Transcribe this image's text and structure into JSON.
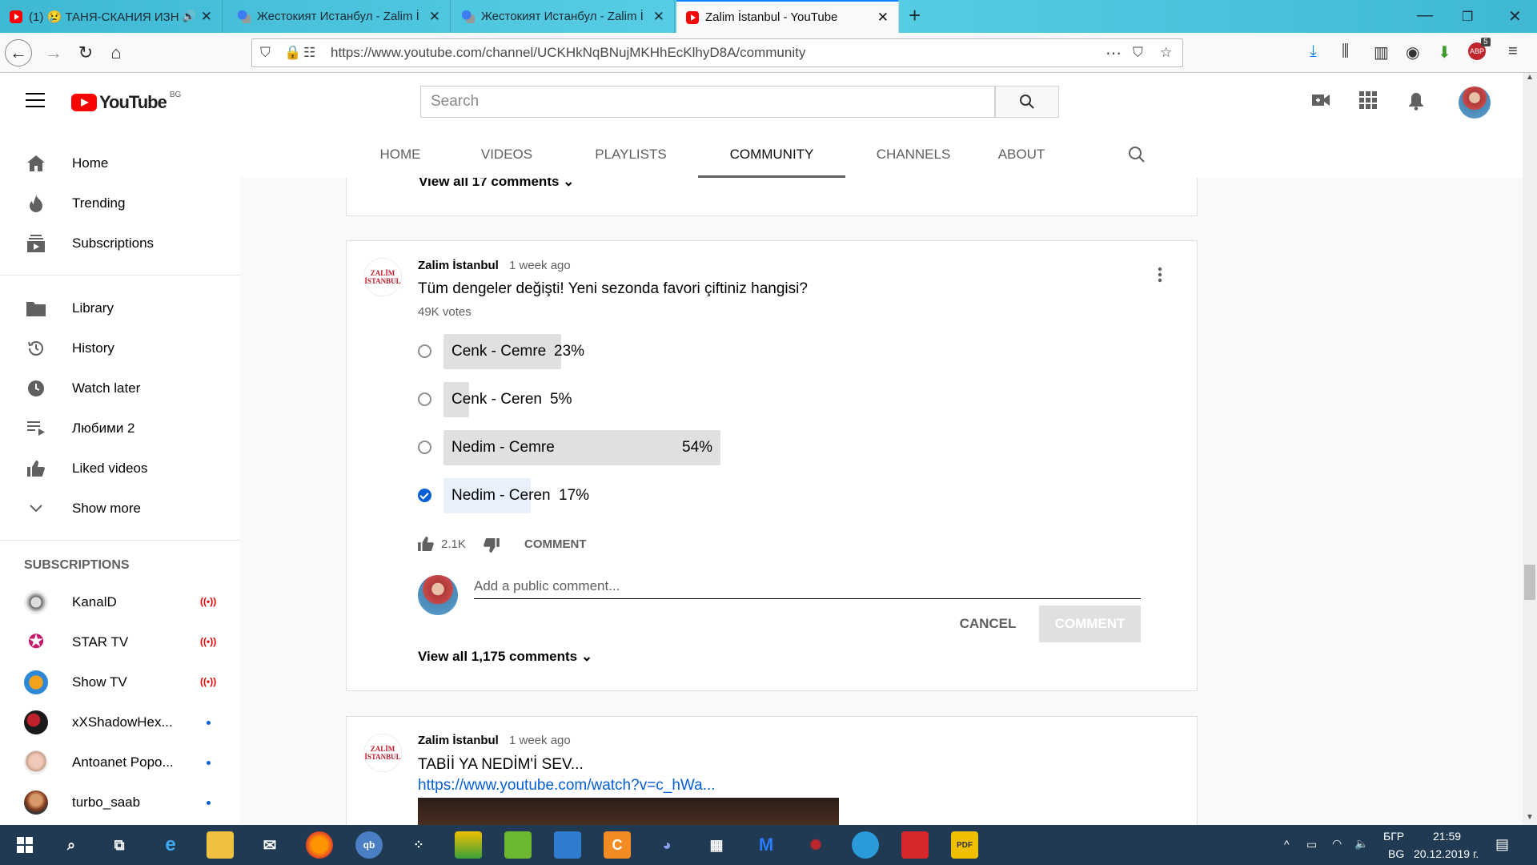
{
  "browser": {
    "tabs": [
      {
        "title": "(1) 😢 ТАНЯ-СКАНИЯ ИЗН",
        "icon": "youtube-icon"
      },
      {
        "title": "Жестокият Истанбул - Zalim İ",
        "icon": "translate-icon"
      },
      {
        "title": "Жестокият Истанбул - Zalim İ",
        "icon": "translate-icon"
      },
      {
        "title": "Zalim İstanbul - YouTube",
        "icon": "youtube-icon"
      }
    ],
    "url": "https://www.youtube.com/channel/UCKHkNqBNujMKHhEcKlhyD8A/community",
    "url_host": "www.youtube.com",
    "addon_badge": "5"
  },
  "youtube": {
    "logo_text": "YouTube",
    "country_code": "BG",
    "search_placeholder": "Search"
  },
  "sidebar": {
    "main": [
      {
        "label": "Home",
        "icon": "home-icon"
      },
      {
        "label": "Trending",
        "icon": "fire-icon"
      },
      {
        "label": "Subscriptions",
        "icon": "subscriptions-icon"
      }
    ],
    "library": [
      {
        "label": "Library",
        "icon": "folder-icon"
      },
      {
        "label": "History",
        "icon": "history-icon"
      },
      {
        "label": "Watch later",
        "icon": "clock-icon"
      },
      {
        "label": "Любими 2",
        "icon": "playlist-icon"
      },
      {
        "label": "Liked videos",
        "icon": "thumbs-up-icon"
      },
      {
        "label": "Show more",
        "icon": "chevron-down-icon"
      }
    ],
    "subscriptions_heading": "SUBSCRIPTIONS",
    "subscriptions": [
      {
        "name": "KanalD",
        "status": "live"
      },
      {
        "name": "STAR TV",
        "status": "live"
      },
      {
        "name": "Show TV",
        "status": "live"
      },
      {
        "name": "xXShadowHex...",
        "status": "new"
      },
      {
        "name": "Antoanet Popo...",
        "status": "new"
      },
      {
        "name": "turbo_saab",
        "status": "new"
      }
    ]
  },
  "channel_tabs": [
    "HOME",
    "VIDEOS",
    "PLAYLISTS",
    "COMMUNITY",
    "CHANNELS",
    "ABOUT"
  ],
  "selected_tab": "COMMUNITY",
  "prev_post": {
    "view_all": "View all 17 comments"
  },
  "poll_post": {
    "author": "Zalim İstanbul",
    "avatar_text": [
      "ZALİM",
      "İSTANBUL"
    ],
    "time": "1 week ago",
    "text": "Tüm dengeler değişti! Yeni sezonda favori çiftiniz hangisi?",
    "votes": "49K votes",
    "options": [
      {
        "label": "Cenk - Cemre",
        "percent": "23%",
        "fraction": 0.23,
        "selected": false
      },
      {
        "label": "Cenk - Ceren",
        "percent": "5%",
        "fraction": 0.05,
        "selected": false
      },
      {
        "label": "Nedim - Cemre",
        "percent": "54%",
        "fraction": 0.54,
        "selected": false
      },
      {
        "label": "Nedim - Ceren",
        "percent": "17%",
        "fraction": 0.17,
        "selected": true
      }
    ],
    "likes": "2.1K",
    "comment_label": "COMMENT",
    "comment_placeholder": "Add a public comment...",
    "cancel_label": "CANCEL",
    "submit_label": "COMMENT",
    "view_all": "View all 1,175 comments"
  },
  "next_post": {
    "author": "Zalim İstanbul",
    "time": "1 week ago",
    "text": "TABİİ YA NEDİM'İ SEV...",
    "link": "https://www.youtube.com/watch?v=c_hWa..."
  },
  "taskbar": {
    "lang_top": "БГР",
    "lang_bottom": "BG",
    "time": "21:59",
    "date": "20.12.2019 г."
  },
  "colors": {
    "accent": "#065fd4",
    "youtube_red": "#ff0000",
    "taskbar": "#1f3a52"
  }
}
